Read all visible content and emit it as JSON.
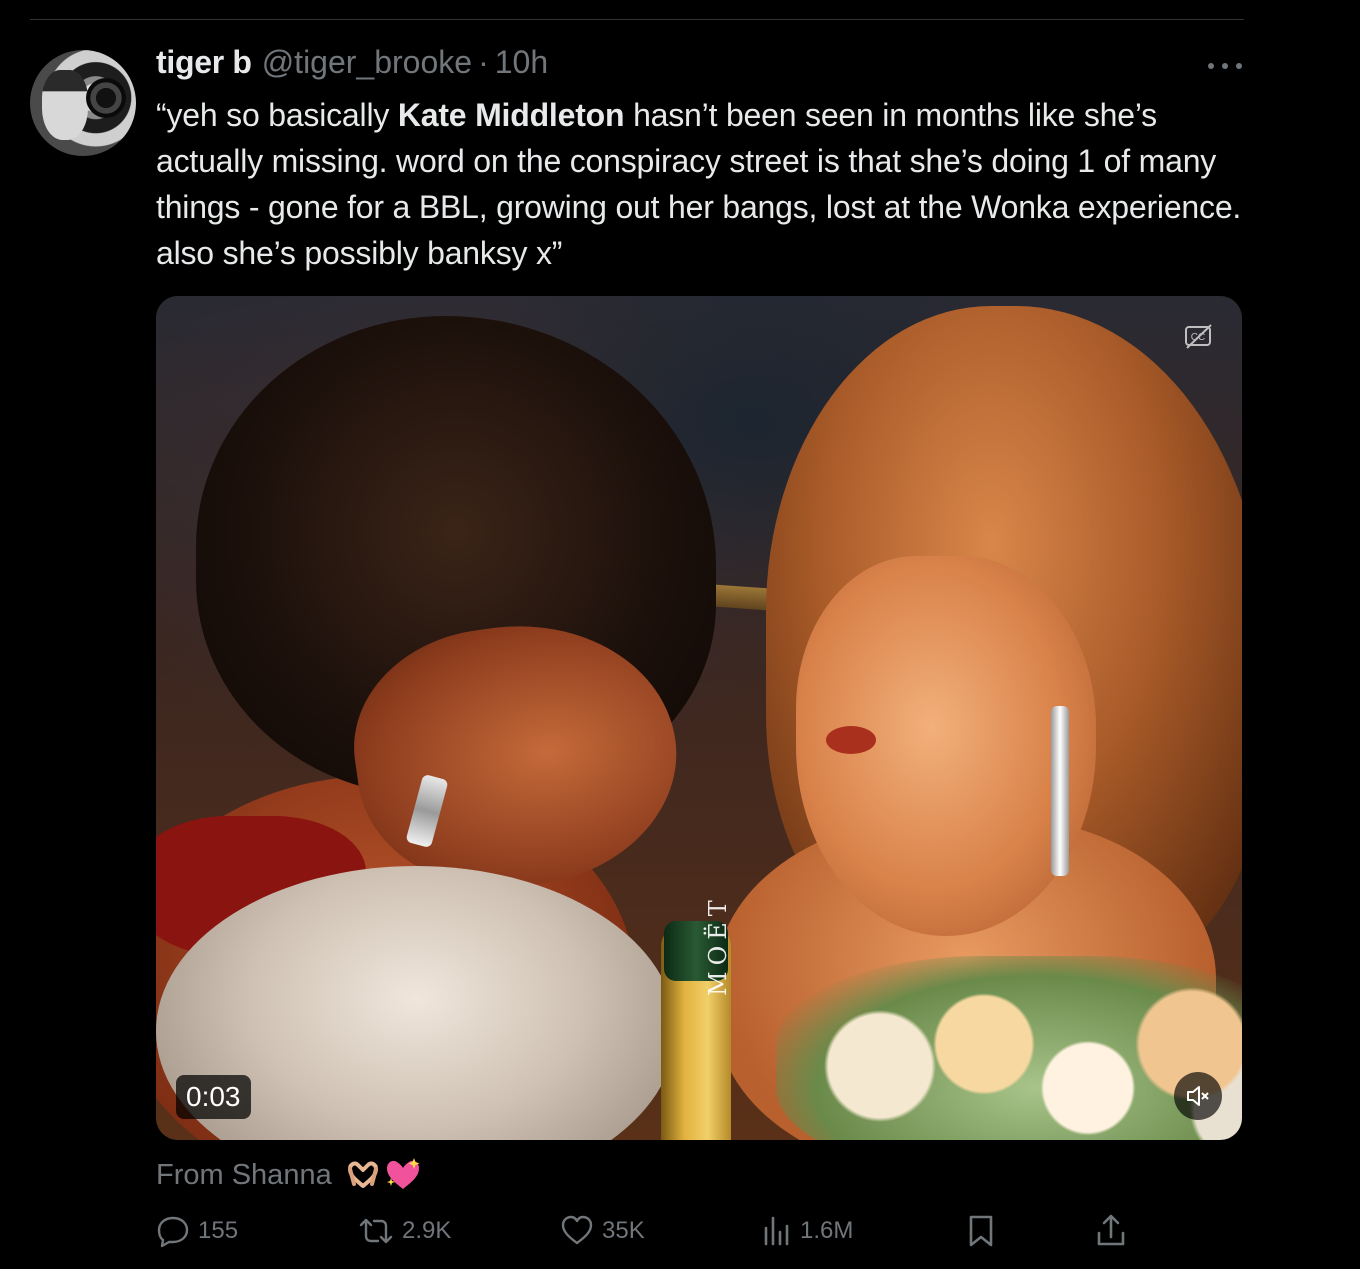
{
  "tweet": {
    "author_name": "tiger b",
    "handle": "@tiger_brooke",
    "separator": "·",
    "time": "10h",
    "text_part1": "“yeh so basically ",
    "text_bold": "Kate Middleton",
    "text_part2": " hasn’t been seen in months like she’s actually missing. word on the conspiracy street is that she’s doing 1 of many things - gone for a BBL, growing out her bangs, lost at the Wonka experience. also she’s possibly banksy x”"
  },
  "media": {
    "duration": "0:03",
    "bottle_label": "MOËT",
    "captions_icon": "cc-off-icon",
    "mute_icon": "speaker-muted-icon"
  },
  "source": {
    "text": "From Shanna",
    "emojis": [
      "heart-hands-emoji",
      "sparkling-heart-emoji"
    ]
  },
  "actions": {
    "replies": "155",
    "reposts": "2.9K",
    "likes": "35K",
    "views": "1.6M",
    "icons": [
      "reply-icon",
      "repost-icon",
      "like-icon",
      "views-icon",
      "bookmark-icon",
      "share-icon"
    ]
  },
  "colors": {
    "background": "#000000",
    "text_primary": "#e7e9ea",
    "text_secondary": "#71767b",
    "divider": "#2f3336"
  }
}
